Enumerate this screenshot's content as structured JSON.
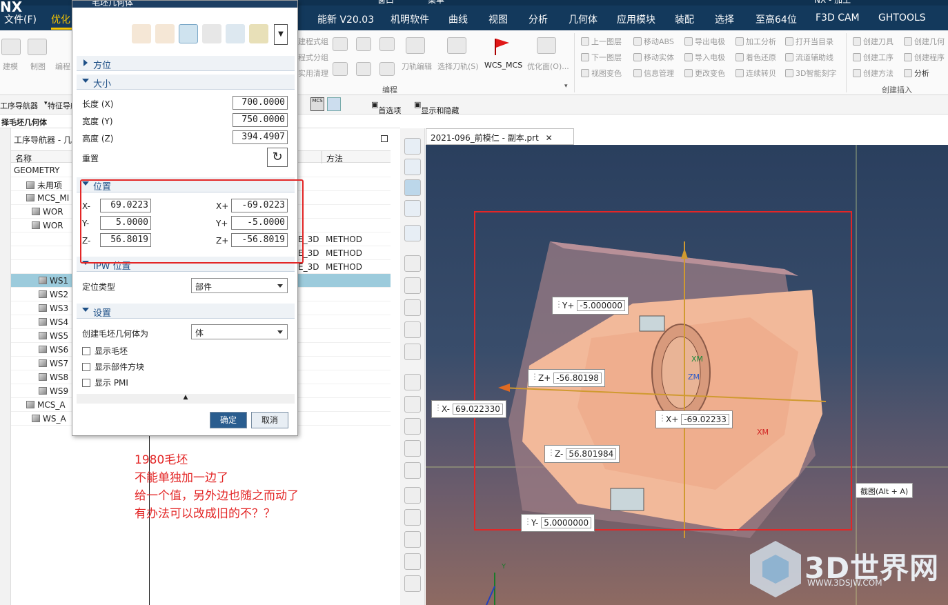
{
  "app": {
    "title": "NX - 加工",
    "top_menu": "窗口",
    "top_menu2": "菜单"
  },
  "menubar": {
    "file": "文件(F)",
    "tab_active": "优化",
    "items": [
      "能新 V20.03",
      "机明软件",
      "曲线",
      "视图",
      "分析",
      "几何体",
      "应用模块",
      "装配",
      "选择",
      "至高64位",
      "F3D CAM",
      "GHTOOLS"
    ]
  },
  "ribbon": {
    "left_labels": [
      "建模",
      "制图",
      "编程"
    ],
    "prog_labels": [
      "建程式组",
      "程式分组",
      "实用清理"
    ],
    "icon_labels": [
      "刀轨编辑",
      "选择刀轨(S)",
      "WCS_MCS",
      "优化面(O)..."
    ],
    "group_label": "编程",
    "right_a": [
      "上一图层",
      "下一图层",
      "视图变色"
    ],
    "right_b": [
      "移动ABS",
      "移动实体",
      "信息管理"
    ],
    "right_c": [
      "导出电极",
      "导入电极",
      "更改变色"
    ],
    "right_d": [
      "加工分析",
      "着色还原",
      "连续转贝"
    ],
    "right_e": [
      "打开当目录",
      "流道辅助线",
      "3D智能刻字"
    ],
    "right_f": [
      "创建刀具",
      "创建工序",
      "创建方法"
    ],
    "right_g": [
      "创建几何",
      "创建程序",
      "分析"
    ],
    "group2_label": "创建插入"
  },
  "toolbar2": {
    "nav1": "工序导航器",
    "nav2": "特征导航",
    "pref": "首选项",
    "showhide": "显示和隐藏"
  },
  "left_header": "择毛坯几何体",
  "navigator": {
    "title": "工序导航器 - 几",
    "col_name": "名称",
    "col_method": "方法",
    "rows": [
      {
        "name": "GEOMETRY",
        "mid": "",
        "method": ""
      },
      {
        "name": "未用项",
        "mid": "",
        "method": ""
      },
      {
        "name": "MCS_MI",
        "mid": "",
        "method": ""
      },
      {
        "name": "WOR",
        "mid": "",
        "method": ""
      },
      {
        "name": "WOR",
        "mid": "",
        "method": ""
      },
      {
        "name": "",
        "mid": "E_3D",
        "method": "METHOD"
      },
      {
        "name": "",
        "mid": "E_3D",
        "method": "METHOD"
      },
      {
        "name": "",
        "mid": "E_3D",
        "method": "METHOD"
      },
      {
        "name": "WS1",
        "mid": "",
        "method": ""
      },
      {
        "name": "WS2",
        "mid": "",
        "method": ""
      },
      {
        "name": "WS3",
        "mid": "",
        "method": ""
      },
      {
        "name": "WS4",
        "mid": "",
        "method": ""
      },
      {
        "name": "WS5",
        "mid": "",
        "method": ""
      },
      {
        "name": "WS6",
        "mid": "",
        "method": ""
      },
      {
        "name": "WS7",
        "mid": "",
        "method": ""
      },
      {
        "name": "WS8",
        "mid": "",
        "method": ""
      },
      {
        "name": "WS9",
        "mid": "",
        "method": ""
      },
      {
        "name": "MCS_A",
        "mid": "",
        "method": ""
      },
      {
        "name": "WS_A",
        "mid": "",
        "method": ""
      }
    ]
  },
  "dialog": {
    "title": "毛坯几何体",
    "sec_orient": "方位",
    "sec_size": "大小",
    "length_label": "长度 (X)",
    "length_value": "700.0000",
    "width_label": "宽度 (Y)",
    "width_value": "750.0000",
    "height_label": "高度 (Z)",
    "height_value": "394.4907",
    "reset_label": "重置",
    "sec_position": "位置",
    "xm_label": "X-",
    "xm_value": "69.0223",
    "ym_label": "Y-",
    "ym_value": "5.0000",
    "zm_label": "Z-",
    "zm_value": "56.8019",
    "xp_label": "X+",
    "xp_value": "-69.0223",
    "yp_label": "Y+",
    "yp_value": "-5.0000",
    "zp_label": "Z+",
    "zp_value": "-56.8019",
    "sec_ipw": "IPW 位置",
    "loc_type_label": "定位类型",
    "loc_type_value": "部件",
    "sec_settings": "设置",
    "create_as_label": "创建毛坯几何体为",
    "create_as_value": "体",
    "show_blank": "显示毛坯",
    "show_block": "显示部件方块",
    "show_pmi": "显示 PMI",
    "ok": "确定",
    "cancel": "取消"
  },
  "viewport": {
    "tab_title": "2021-096_前模仁 - 副本.prt",
    "labels": {
      "yplus": "Y+",
      "yplus_val": "-5.000000",
      "zplus": "Z+",
      "zplus_val": "-56.80198",
      "xminus": "X-",
      "xminus_val": "69.022330",
      "xplus": "X+",
      "xplus_val": "-69.02233",
      "zminus": "Z-",
      "zminus_val": "56.801984",
      "yminus": "Y-",
      "yminus_val": "5.0000000"
    },
    "tooltip": "截图(Alt + A)",
    "axis_y": "Y"
  },
  "annotation": {
    "lines": [
      "1980毛坯",
      "不能单独加一边了",
      "给一个值，另外边也随之而动了",
      "有办法可以改成旧的不？？"
    ]
  },
  "watermark": {
    "brand": "3D世界网",
    "url": "WWW.3DSJW.COM"
  },
  "colors": {
    "accent": "#1d3f63",
    "selection": "#9ccbdc",
    "highlight_red": "#e32626",
    "part": "#f2b99a"
  }
}
